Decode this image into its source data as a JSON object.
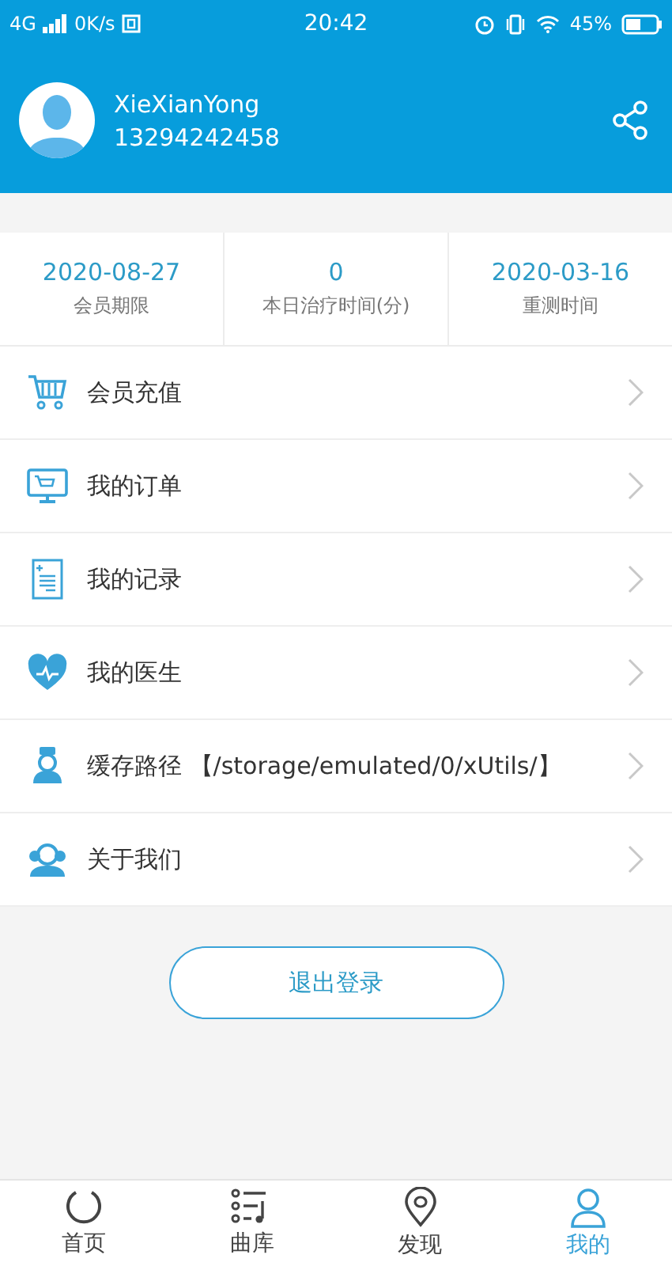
{
  "status_bar": {
    "network": "4G",
    "speed": "0K/s",
    "time": "20:42",
    "battery": "45%"
  },
  "profile": {
    "name": "XieXianYong",
    "phone": "13294242458"
  },
  "stats": [
    {
      "value": "2020-08-27",
      "label": "会员期限"
    },
    {
      "value": "0",
      "label": "本日治疗时间(分)"
    },
    {
      "value": "2020-03-16",
      "label": "重测时间"
    }
  ],
  "menu": [
    {
      "label": "会员充值"
    },
    {
      "label": "我的订单"
    },
    {
      "label": "我的记录"
    },
    {
      "label": "我的医生"
    },
    {
      "label": "缓存路径 【/storage/emulated/0/xUtils/】"
    },
    {
      "label": "关于我们"
    }
  ],
  "logout_button": "退出登录",
  "tabs": [
    {
      "label": "首页",
      "selected": false
    },
    {
      "label": "曲库",
      "selected": false
    },
    {
      "label": "发现",
      "selected": false
    },
    {
      "label": "我的",
      "selected": true
    }
  ]
}
